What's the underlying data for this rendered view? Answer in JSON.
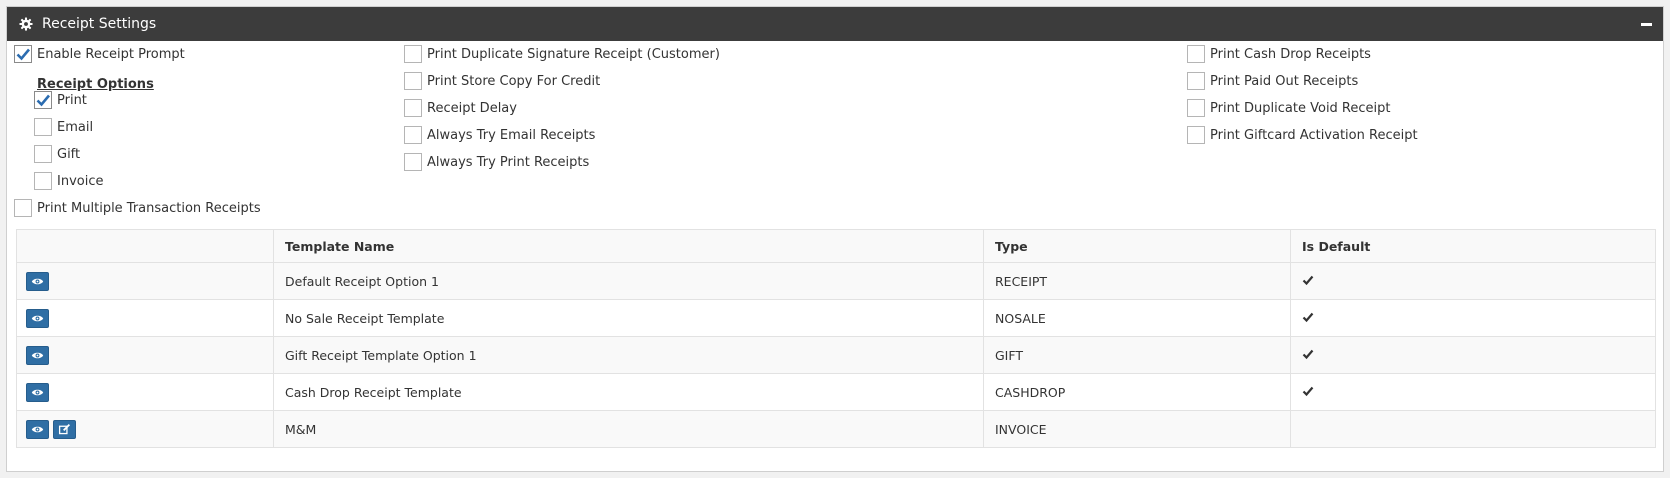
{
  "panel": {
    "title": "Receipt Settings",
    "header_icon": "gear-icon",
    "collapse_icon": "minus-icon"
  },
  "options": {
    "col1": [
      {
        "label": "Enable Receipt Prompt",
        "checked": true
      },
      {
        "label": "Print Multiple Transaction Receipts",
        "checked": false
      }
    ],
    "receipt_options": {
      "heading": "Receipt Options",
      "items": [
        {
          "label": "Print",
          "checked": true
        },
        {
          "label": "Email",
          "checked": false
        },
        {
          "label": "Gift",
          "checked": false
        },
        {
          "label": "Invoice",
          "checked": false
        }
      ]
    },
    "col2": [
      {
        "label": "Print Duplicate Signature Receipt (Customer)",
        "checked": false
      },
      {
        "label": "Print Store Copy For Credit",
        "checked": false
      },
      {
        "label": "Receipt Delay",
        "checked": false
      },
      {
        "label": "Always Try Email Receipts",
        "checked": false
      },
      {
        "label": "Always Try Print Receipts",
        "checked": false
      }
    ],
    "col3": [
      {
        "label": "Print Cash Drop Receipts",
        "checked": false
      },
      {
        "label": "Print Paid Out Receipts",
        "checked": false
      },
      {
        "label": "Print Duplicate Void Receipt",
        "checked": false
      },
      {
        "label": "Print Giftcard Activation Receipt",
        "checked": false
      }
    ]
  },
  "table": {
    "headers": [
      "",
      "Template Name",
      "Type",
      "Is Default"
    ],
    "rows": [
      {
        "name": "Default Receipt Option 1",
        "type": "RECEIPT",
        "is_default": true,
        "buttons": [
          "eye-icon"
        ]
      },
      {
        "name": "No Sale Receipt Template",
        "type": "NOSALE",
        "is_default": true,
        "buttons": [
          "eye-icon"
        ]
      },
      {
        "name": "Gift Receipt Template Option 1",
        "type": "GIFT",
        "is_default": true,
        "buttons": [
          "eye-icon"
        ]
      },
      {
        "name": "Cash Drop Receipt Template",
        "type": "CASHDROP",
        "is_default": true,
        "buttons": [
          "eye-icon"
        ]
      },
      {
        "name": "M&M",
        "type": "INVOICE",
        "is_default": false,
        "buttons": [
          "eye-icon",
          "edit-icon"
        ]
      }
    ]
  },
  "colors": {
    "header_bg": "#3c3c3c",
    "button_bg": "#2f6ea4",
    "check_color": "#2b6cb0"
  }
}
